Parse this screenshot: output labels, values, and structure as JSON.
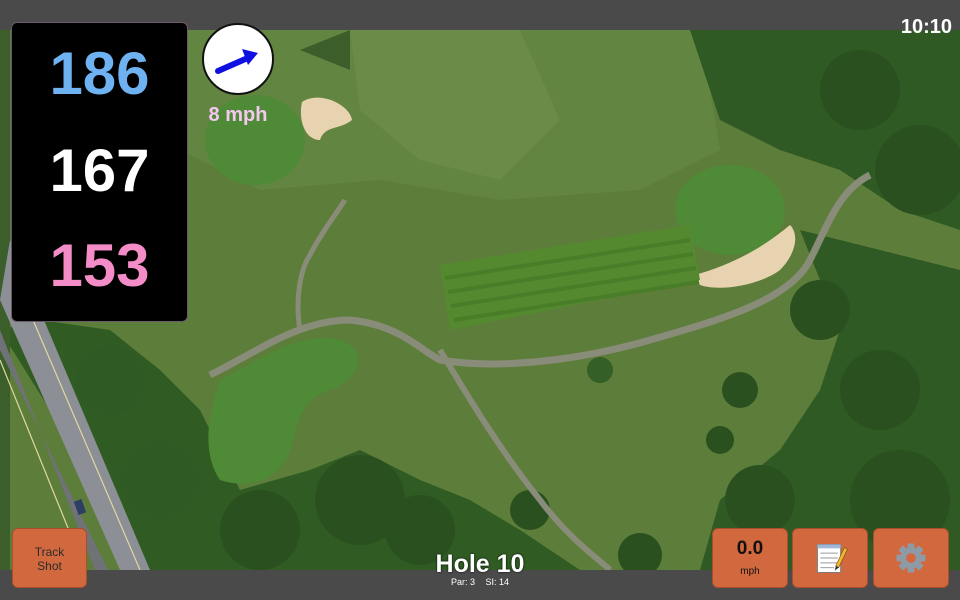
{
  "status": {
    "clock": "10:10"
  },
  "distances": {
    "back": "186",
    "center": "167",
    "front": "153",
    "colors": {
      "back": "#6fb2f2",
      "center": "#ffffff",
      "front": "#f48cc8"
    }
  },
  "wind": {
    "label": "8 mph",
    "arrow_icon": "wind-arrow-icon",
    "arrow_color": "#1010e0"
  },
  "buttons": {
    "track_shot": "Track\nShot",
    "speed_value": "0.0",
    "speed_unit": "mph",
    "notes_icon": "notepad-icon",
    "settings_icon": "gear-icon"
  },
  "hole": {
    "title": "Hole 10",
    "par": "Par: 3",
    "si": "SI: 14"
  },
  "colors": {
    "button": "#d2693e",
    "bar": "#4a4a4a",
    "panel": "#000000"
  }
}
